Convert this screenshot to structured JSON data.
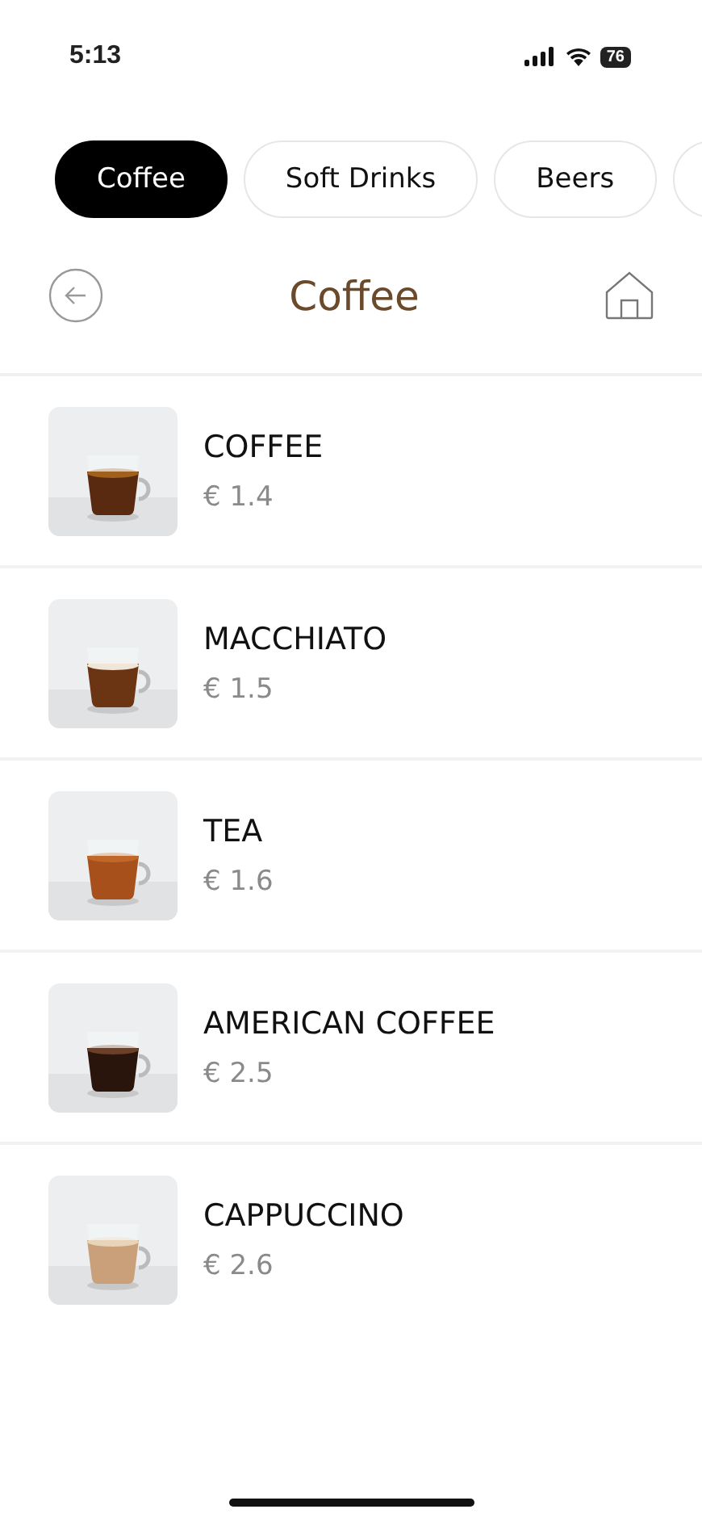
{
  "status_bar": {
    "time": "5:13",
    "battery": "76"
  },
  "tabs": [
    {
      "label": "Coffee",
      "selected": true
    },
    {
      "label": "Soft Drinks",
      "selected": false
    },
    {
      "label": "Beers",
      "selected": false
    },
    {
      "selected": false
    }
  ],
  "header": {
    "title": "Coffee"
  },
  "products": [
    {
      "name": "COFFEE",
      "price": "€ 1.4"
    },
    {
      "name": "MACCHIATO",
      "price": "€ 1.5"
    },
    {
      "name": "TEA",
      "price": "€ 1.6"
    },
    {
      "name": "AMERICAN COFFEE",
      "price": "€ 2.5"
    },
    {
      "name": "CAPPUCCINO",
      "price": "€ 2.6"
    }
  ]
}
